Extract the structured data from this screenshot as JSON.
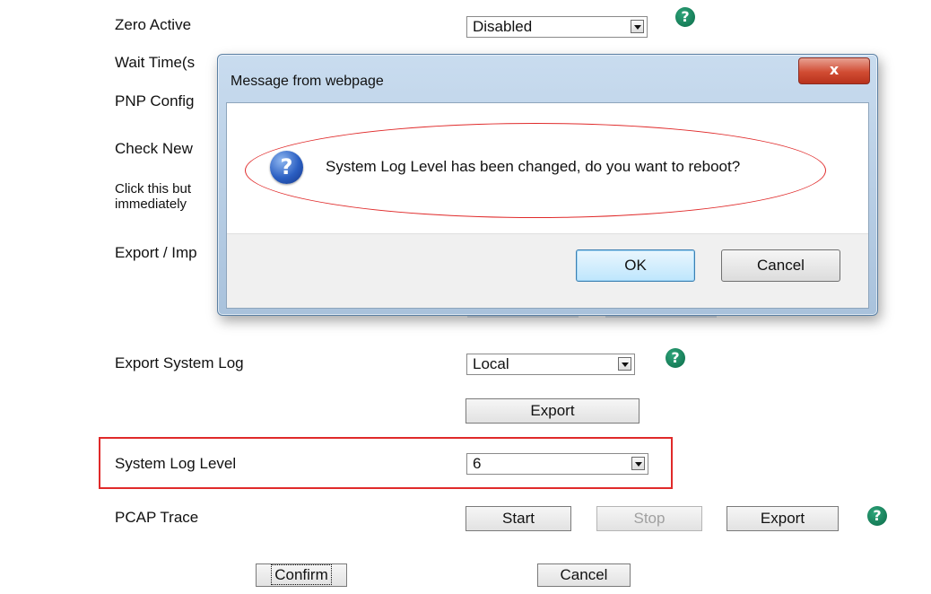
{
  "page": {
    "rows": {
      "zero_active": {
        "label": "Zero Active",
        "value": "Disabled"
      },
      "wait_time": {
        "label": "Wait Time(s"
      },
      "pnp_config": {
        "label": "PNP Config"
      },
      "check_new": {
        "label": "Check New"
      },
      "click_note": {
        "label": "Click this but immediately"
      },
      "export_import": {
        "label": "Export / Imp"
      },
      "export_system_log": {
        "label": "Export System Log",
        "value": "Local",
        "export_button": "Export"
      },
      "system_log_level": {
        "label": "System Log Level",
        "value": "6"
      },
      "pcap_trace": {
        "label": "PCAP Trace",
        "start": "Start",
        "stop": "Stop",
        "export": "Export"
      }
    },
    "actions": {
      "confirm": "Confirm",
      "cancel": "Cancel"
    },
    "help_glyph": "?"
  },
  "dialog": {
    "title": "Message from webpage",
    "close_glyph": "x",
    "icon_glyph": "?",
    "message": "System Log Level has been changed, do you want to reboot?",
    "ok_label": "OK",
    "cancel_label": "Cancel"
  },
  "colors": {
    "highlight": "#e02a2a",
    "help_icon": "#0b6b48",
    "dialog_frame": "#a9c2dc",
    "close_button": "#d14c33"
  }
}
